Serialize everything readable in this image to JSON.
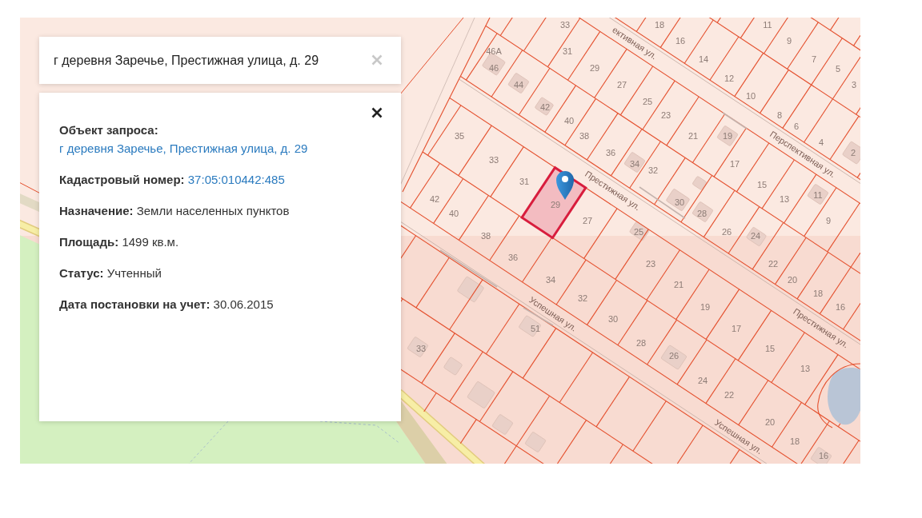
{
  "search": {
    "value": "г деревня Заречье, Престижная улица, д. 29"
  },
  "info_card": {
    "fields": [
      {
        "label": "Объект запроса:",
        "value": "г деревня Заречье, Престижная улица, д. 29",
        "kind": "link"
      },
      {
        "label": "Кадастровый номер:",
        "value": "37:05:010442:485",
        "kind": "link"
      },
      {
        "label": "Назначение:",
        "value": "Земли населенных пунктов",
        "kind": "text"
      },
      {
        "label": "Площадь:",
        "value": "1499 кв.м.",
        "kind": "text"
      },
      {
        "label": "Статус:",
        "value": "Учтенный",
        "kind": "text"
      },
      {
        "label": "Дата постановки на учет:",
        "value": "30.06.2015",
        "kind": "text"
      }
    ]
  },
  "map": {
    "street_labels": [
      "ективная ул.",
      "Перспективная ул.",
      "Престижная ул.",
      "Успешная ул.",
      "Престижная ул.",
      "Успешная ул."
    ],
    "parcel_numbers": [
      "33",
      "18",
      "11",
      "16",
      "9",
      "46А",
      "31",
      "14",
      "7",
      "46",
      "29",
      "5",
      "12",
      "44",
      "27",
      "3",
      "10",
      "25",
      "42",
      "23",
      "8",
      "40",
      "6",
      "35",
      "38",
      "21",
      "19",
      "4",
      "36",
      "2",
      "33",
      "34",
      "17",
      "32",
      "31",
      "15",
      "11",
      "42",
      "13",
      "30",
      "40",
      "28",
      "27",
      "9",
      "25",
      "26",
      "38",
      "24",
      "36",
      "23",
      "22",
      "34",
      "20",
      "21",
      "18",
      "32",
      "19",
      "16",
      "30",
      "51",
      "17",
      "28",
      "33",
      "15",
      "26",
      "13",
      "24",
      "22",
      "20",
      "18",
      "16"
    ],
    "selected_parcel": {
      "number": "29"
    }
  }
}
